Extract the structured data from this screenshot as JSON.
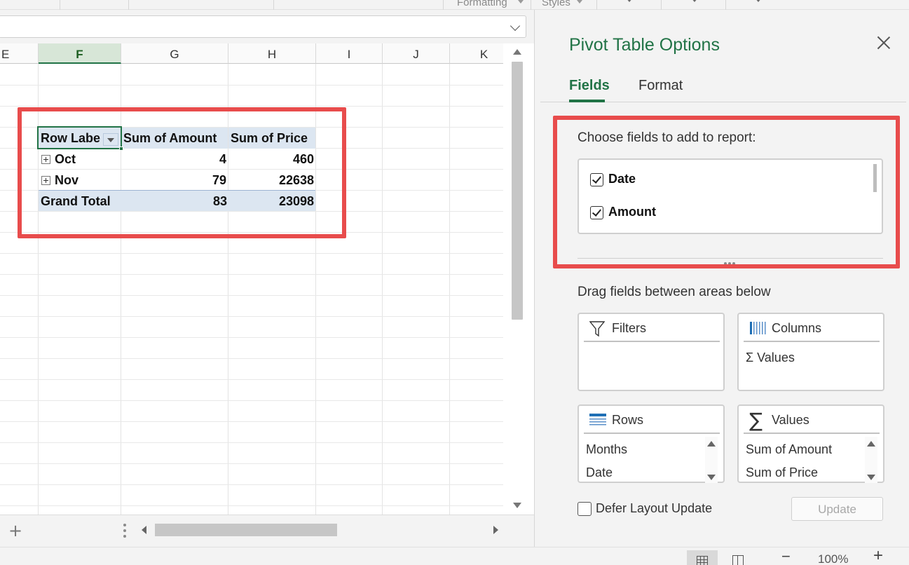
{
  "ribbon": {
    "groups": [
      {
        "label": "Formatting"
      },
      {
        "label": "Styles"
      }
    ]
  },
  "sheet": {
    "columns": [
      "E",
      "F",
      "G",
      "H",
      "I",
      "J",
      "K"
    ],
    "active_column": "F"
  },
  "pivot": {
    "headers": [
      "Row Labe",
      "Sum of Amount",
      "Sum of Price"
    ],
    "rows": [
      {
        "label": "Oct",
        "amount": "4",
        "price": "460"
      },
      {
        "label": "Nov",
        "amount": "79",
        "price": "22638"
      }
    ],
    "total": {
      "label": "Grand Total",
      "amount": "83",
      "price": "23098"
    }
  },
  "status": {
    "zoom": "100%",
    "minus": "−",
    "plus": "+"
  },
  "sheetbar": {
    "add": "+"
  },
  "panel": {
    "title": "Pivot Table Options",
    "tabs": [
      "Fields",
      "Format"
    ],
    "active_tab": "Fields",
    "choose_label": "Choose fields to add to report:",
    "fields": [
      {
        "name": "Date",
        "checked": true
      },
      {
        "name": "Amount",
        "checked": true
      }
    ],
    "drag_label": "Drag fields between areas below",
    "areas": {
      "filters": {
        "title": "Filters",
        "items": []
      },
      "columns": {
        "title": "Columns",
        "items": [
          "Σ Values"
        ]
      },
      "rows": {
        "title": "Rows",
        "items": [
          "Months",
          "Date"
        ]
      },
      "values": {
        "title": "Values",
        "items": [
          "Sum of Amount",
          "Sum of Price"
        ]
      }
    },
    "defer_label": "Defer Layout Update",
    "update_label": "Update"
  },
  "colors": {
    "accent": "#217346",
    "highlight": "#e84c4c",
    "pivot_header": "#dce6f1"
  }
}
